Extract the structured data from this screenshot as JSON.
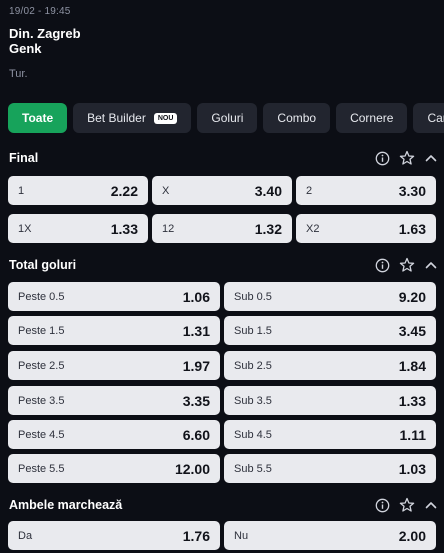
{
  "match": {
    "datetime": "19/02 - 19:45",
    "home": "Din. Zagreb",
    "away": "Genk",
    "stage": "Tur."
  },
  "tabs": [
    {
      "label": "Toate",
      "active": true
    },
    {
      "label": "Bet Builder",
      "badge": "NOU"
    },
    {
      "label": "Goluri"
    },
    {
      "label": "Combo"
    },
    {
      "label": "Cornere"
    },
    {
      "label": "Cartonașe"
    }
  ],
  "sections": {
    "final": {
      "title": "Final",
      "odds": [
        {
          "label": "1",
          "value": "2.22"
        },
        {
          "label": "X",
          "value": "3.40"
        },
        {
          "label": "2",
          "value": "3.30"
        },
        {
          "label": "1X",
          "value": "1.33"
        },
        {
          "label": "12",
          "value": "1.32"
        },
        {
          "label": "X2",
          "value": "1.63"
        }
      ]
    },
    "total_goluri": {
      "title": "Total goluri",
      "odds": [
        {
          "label": "Peste 0.5",
          "value": "1.06"
        },
        {
          "label": "Sub 0.5",
          "value": "9.20"
        },
        {
          "label": "Peste 1.5",
          "value": "1.31"
        },
        {
          "label": "Sub 1.5",
          "value": "3.45"
        },
        {
          "label": "Peste 2.5",
          "value": "1.97"
        },
        {
          "label": "Sub 2.5",
          "value": "1.84"
        },
        {
          "label": "Peste 3.5",
          "value": "3.35"
        },
        {
          "label": "Sub 3.5",
          "value": "1.33"
        },
        {
          "label": "Peste 4.5",
          "value": "6.60"
        },
        {
          "label": "Sub 4.5",
          "value": "1.11"
        },
        {
          "label": "Peste 5.5",
          "value": "12.00"
        },
        {
          "label": "Sub 5.5",
          "value": "1.03"
        }
      ]
    },
    "ambele": {
      "title": "Ambele marchează",
      "odds": [
        {
          "label": "Da",
          "value": "1.76"
        },
        {
          "label": "Nu",
          "value": "2.00"
        }
      ]
    }
  },
  "icons": {
    "info": "info-icon",
    "favorite": "star-icon",
    "collapse": "chevron-up-icon"
  },
  "colors": {
    "background": "#0c0e15",
    "accent": "#17a35b",
    "tab": "#22252f",
    "odd_tile": "#e9eaee"
  }
}
